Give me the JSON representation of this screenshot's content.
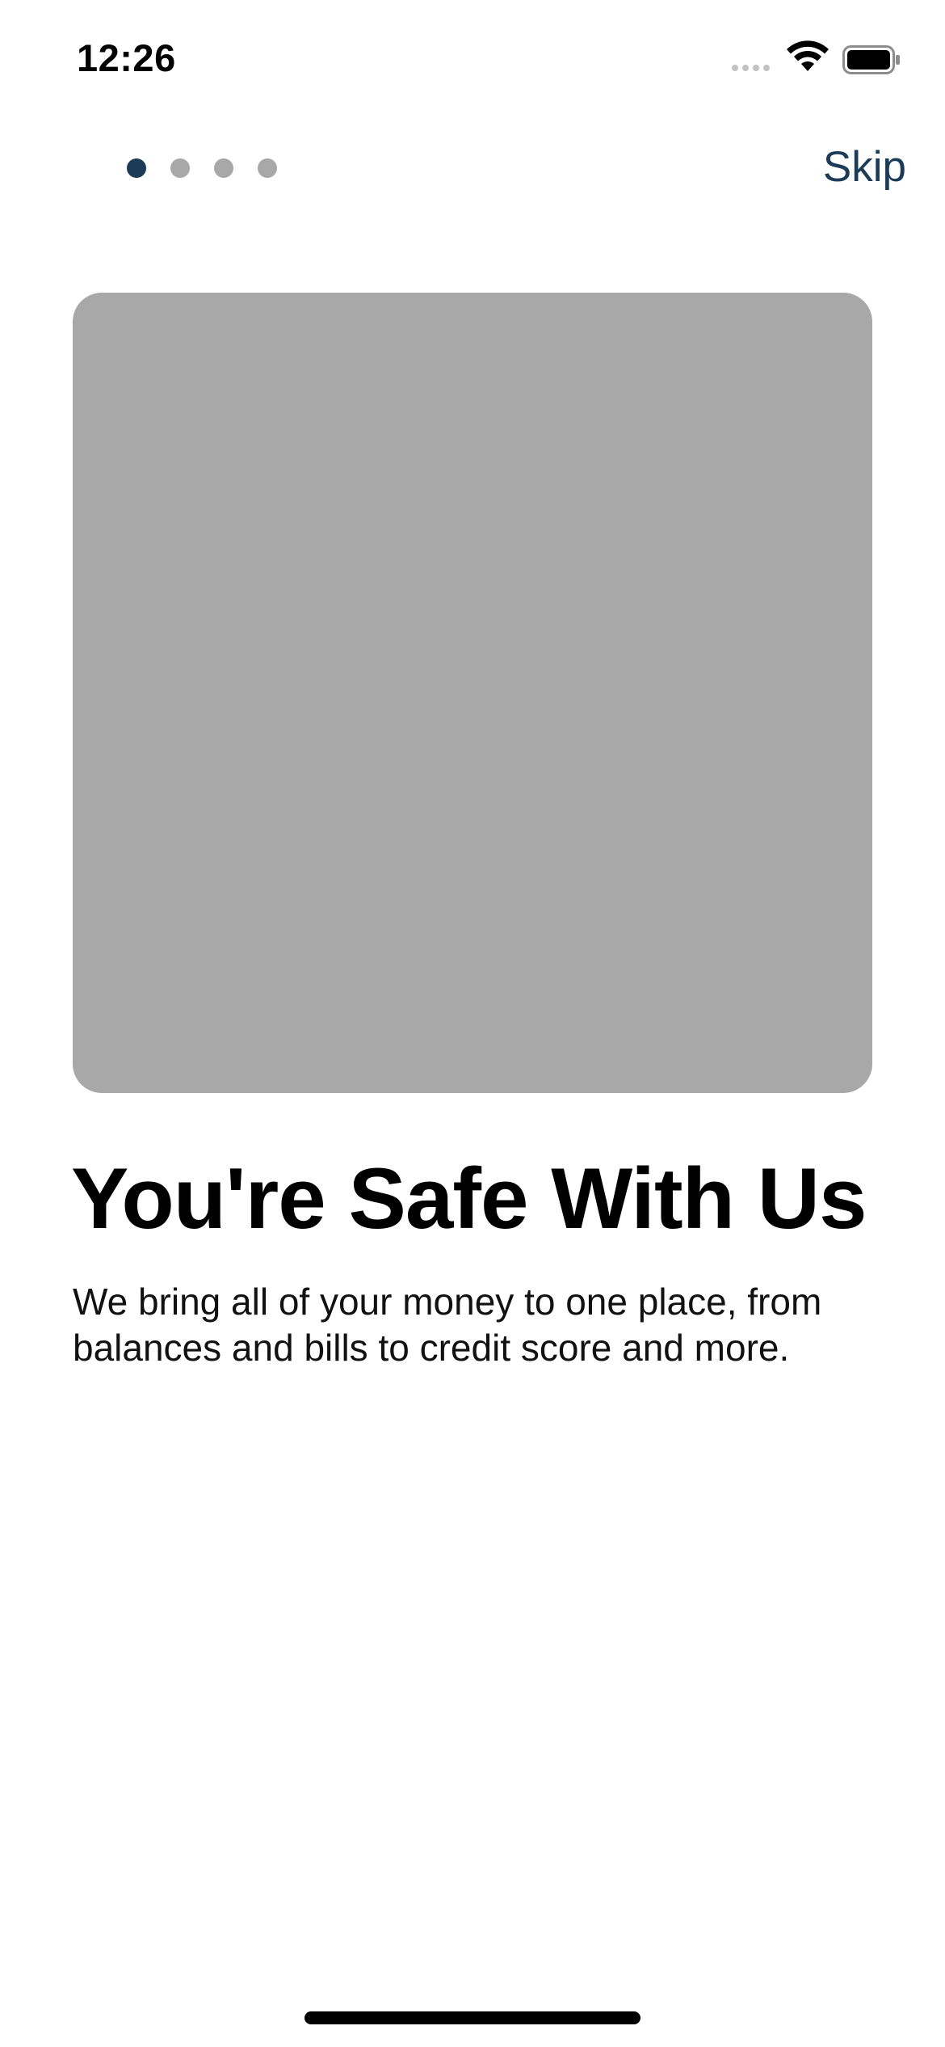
{
  "status_bar": {
    "time": "12:26",
    "icons": [
      "signal-icon",
      "wifi-icon",
      "battery-icon"
    ]
  },
  "onboarding": {
    "page_indicator": {
      "total_pages": 4,
      "current_page": 1
    },
    "skip_label": "Skip",
    "hero_image": "placeholder-image",
    "title": "You're Safe With Us",
    "description": "We bring all of your money to one place, from balances and bills to credit score and more."
  },
  "colors": {
    "accent": "#1b3b57",
    "dot_inactive": "#a8a8a8",
    "placeholder": "#a8a8a8",
    "background": "#ffffff",
    "text": "#000000"
  }
}
